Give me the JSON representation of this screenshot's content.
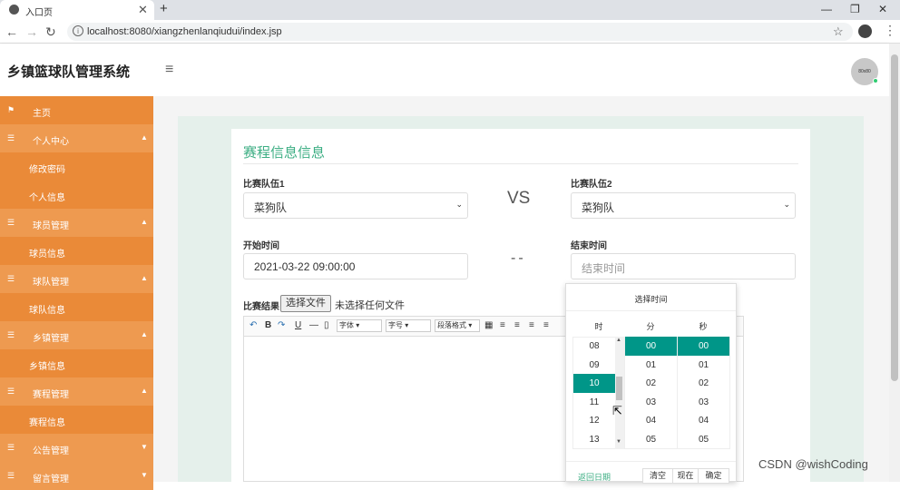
{
  "browser": {
    "tab_title": "入口页",
    "url": "localhost:8080/xiangzhenlanqiudui/index.jsp"
  },
  "app": {
    "title": "乡镇篮球队管理系统",
    "avatar_text": "80x80"
  },
  "sidebar": {
    "items": [
      {
        "label": "主页"
      },
      {
        "label": "个人中心"
      },
      {
        "label": "修改密码"
      },
      {
        "label": "个人信息"
      },
      {
        "label": "球员管理"
      },
      {
        "label": "球员信息"
      },
      {
        "label": "球队管理"
      },
      {
        "label": "球队信息"
      },
      {
        "label": "乡镇管理"
      },
      {
        "label": "乡镇信息"
      },
      {
        "label": "赛程管理"
      },
      {
        "label": "赛程信息"
      },
      {
        "label": "公告管理"
      },
      {
        "label": "留言管理"
      }
    ]
  },
  "form": {
    "title": "赛程信息信息",
    "team1_label": "比赛队伍1",
    "team1_value": "菜狗队",
    "vs": "VS",
    "team2_label": "比赛队伍2",
    "team2_value": "菜狗队",
    "start_label": "开始时间",
    "start_value": "2021-03-22 09:00:00",
    "dash": "--",
    "end_label": "结束时间",
    "end_placeholder": "结束时间",
    "result_label": "比赛结果",
    "file_button": "选择文件",
    "file_status": "未选择任何文件"
  },
  "editor": {
    "font_select": "字体",
    "size_select": "字号",
    "para_select": "段落格式"
  },
  "time_picker": {
    "title": "选择时间",
    "col_hour": "时",
    "col_min": "分",
    "col_sec": "秒",
    "hours": [
      "08",
      "09",
      "10",
      "11",
      "12",
      "13"
    ],
    "minutes": [
      "00",
      "01",
      "02",
      "03",
      "04",
      "05"
    ],
    "seconds": [
      "00",
      "01",
      "02",
      "03",
      "04",
      "05"
    ],
    "selected_hour": "10",
    "selected_minute": "00",
    "selected_second": "00",
    "back_label": "返回日期",
    "clear": "清空",
    "now": "现在",
    "confirm": "确定"
  },
  "watermark": "CSDN @wishCoding",
  "colors": {
    "sidebar": "#ea8a38",
    "accent": "#3cae83",
    "picker_selected": "#009688"
  }
}
